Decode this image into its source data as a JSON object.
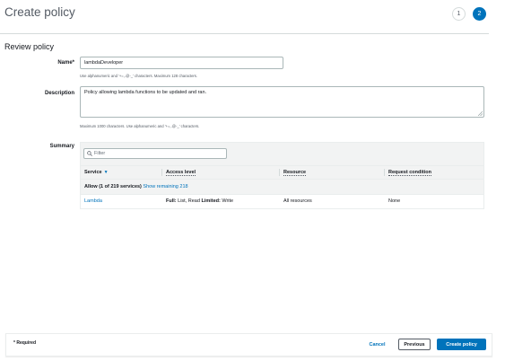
{
  "header": {
    "title": "Create policy",
    "steps": [
      "1",
      "2"
    ]
  },
  "section_title": "Review policy",
  "form": {
    "name_label": "Name*",
    "name_value": "lambdaDeveloper",
    "name_hint": "Use alphanumeric and '+=,.@-_' characters. Maximum 128 characters.",
    "description_label": "Description",
    "description_value": "Policy allowing lambda functions to be updated and ran.",
    "description_hint": "Maximum 1000 characters. Use alphanumeric and '+=,.@-_' characters.",
    "summary_label": "Summary"
  },
  "summary": {
    "filter_placeholder": "Filter",
    "columns": [
      "Service",
      "Access level",
      "Resource",
      "Request condition"
    ],
    "group_text": "Allow (1 of 219 services)",
    "group_link": "Show remaining 218",
    "rows": [
      {
        "service": "Lambda",
        "access_full_label": "Full:",
        "access_full_value": "List, Read",
        "access_limited_label": "Limited:",
        "access_limited_value": "Write",
        "resource": "All resources",
        "request_condition": "None"
      }
    ]
  },
  "footer": {
    "required_note": "* Required",
    "cancel_label": "Cancel",
    "previous_label": "Previous",
    "create_label": "Create policy"
  },
  "colors": {
    "accent": "#0073bb",
    "border": "#d5dbdb",
    "header_bg": "#f2f3f3"
  }
}
